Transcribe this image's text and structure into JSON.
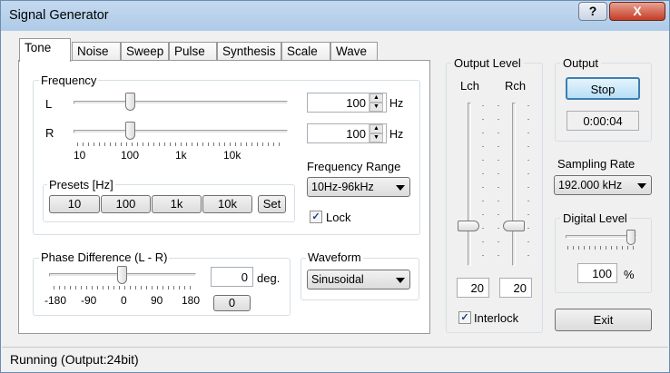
{
  "window": {
    "title": "Signal Generator",
    "help_label": "?",
    "close_label": "X"
  },
  "tabs": [
    "Tone",
    "Noise",
    "Sweep",
    "Pulse",
    "Synthesis",
    "Scale",
    "Wave"
  ],
  "frequency": {
    "label": "Frequency",
    "l_label": "L",
    "r_label": "R",
    "l_value": "100",
    "r_value": "100",
    "unit": "Hz",
    "slider_ticks": [
      "10",
      "100",
      "1k",
      "10k"
    ],
    "l_level": 0.26,
    "r_level": 0.26
  },
  "presets": {
    "label": "Presets [Hz]",
    "buttons": [
      "10",
      "100",
      "1k",
      "10k"
    ],
    "set_label": "Set"
  },
  "frequency_range": {
    "label": "Frequency Range",
    "value": "10Hz-96kHz",
    "lock_label": "Lock",
    "lock_checked": true
  },
  "phase": {
    "label": "Phase Difference (L - R)",
    "value": "0",
    "unit": "deg.",
    "ticks": [
      "-180",
      "-90",
      "0",
      "90",
      "180"
    ],
    "zero_button": "0",
    "level": 0.5
  },
  "waveform": {
    "label": "Waveform",
    "value": "Sinusoidal"
  },
  "output_level": {
    "label": "Output Level",
    "lch_label": "Lch",
    "rch_label": "Rch",
    "lch_value": "20",
    "rch_value": "20",
    "interlock_label": "Interlock",
    "interlock_checked": true
  },
  "output": {
    "label": "Output",
    "stop_label": "Stop",
    "time": "0:00:04"
  },
  "sampling_rate": {
    "label": "Sampling Rate",
    "value": "192.000 kHz"
  },
  "digital_level": {
    "label": "Digital Level",
    "value": "100",
    "unit": "%",
    "level": 1.0
  },
  "exit_label": "Exit",
  "status": {
    "text": "Running (Output:24bit)"
  }
}
